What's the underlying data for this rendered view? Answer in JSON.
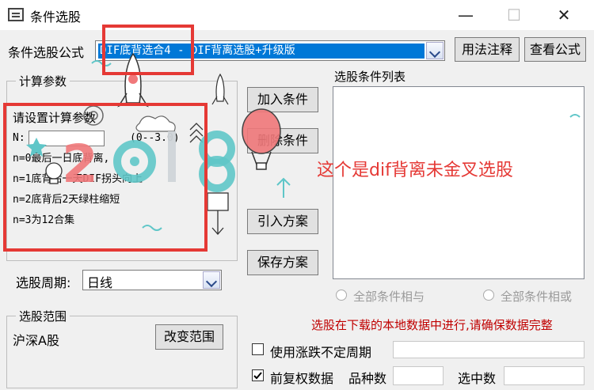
{
  "window": {
    "title": "条件选股",
    "minimize": "—",
    "maximize": "☐",
    "close": "✕"
  },
  "formula": {
    "label": "条件选股公式",
    "selected": "DIF底背选合4 - DIF背离选股+升级版",
    "usage_button": "用法注释",
    "view_button": "查看公式"
  },
  "params": {
    "group_title": "计算参数",
    "lines": [
      "请设置计算参数",
      "N:",
      "n=0最后一日底背离,",
      "n=1底背后一天DIF拐头向上",
      "n=2底背后2天绿柱缩短",
      "n=3为12合集"
    ],
    "n_range": "(0--3.0)"
  },
  "actions": {
    "add_condition": "加入条件",
    "delete_condition": "删除条件",
    "import_plan": "引入方案",
    "save_plan": "保存方案"
  },
  "condition_list": {
    "title": "选股条件列表"
  },
  "annotation": {
    "text": "这个是dif背离未金叉选股"
  },
  "watermark": {
    "text": "2018",
    "color": "#f0787a",
    "accent": "#5fc6c8"
  },
  "period": {
    "label": "选股周期:",
    "selected": "日线"
  },
  "range": {
    "group_title": "选股范围",
    "value": "沪深A股",
    "change_button": "改变范围"
  },
  "logic": {
    "all_and": "全部条件相与",
    "all_or": "全部条件相或"
  },
  "notice": {
    "text": "选股在下载的本地数据中进行,请确保数据完整",
    "color": "#c00000"
  },
  "options": {
    "use_float_period": "使用涨跌不定周期",
    "use_float_period_checked": false,
    "forward_adjust": "前复权数据",
    "forward_adjust_checked": true,
    "stock_count_label": "品种数",
    "selected_count_label": "选中数"
  },
  "highlight_color": "#e53935"
}
